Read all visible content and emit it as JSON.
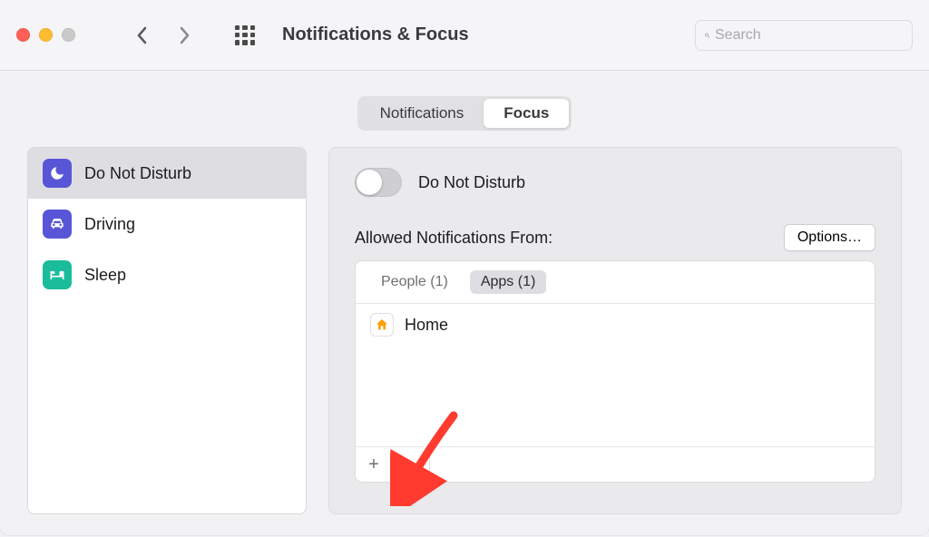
{
  "header": {
    "title": "Notifications & Focus",
    "search_placeholder": "Search"
  },
  "tabs": {
    "items": [
      "Notifications",
      "Focus"
    ],
    "active": 1
  },
  "sidebar": {
    "items": [
      {
        "label": "Do Not Disturb",
        "icon": "moon-icon",
        "color": "purple",
        "selected": true
      },
      {
        "label": "Driving",
        "icon": "car-icon",
        "color": "purple",
        "selected": false
      },
      {
        "label": "Sleep",
        "icon": "bed-icon",
        "color": "teal",
        "selected": false
      }
    ]
  },
  "main": {
    "toggle_label": "Do Not Disturb",
    "toggle_on": false,
    "allowed_heading": "Allowed Notifications From:",
    "options_label": "Options…",
    "filters": {
      "people_label": "People (1)",
      "apps_label": "Apps (1)",
      "active": "apps"
    },
    "apps": [
      {
        "name": "Home",
        "icon": "home-app-icon"
      }
    ],
    "footer": {
      "add": "+",
      "remove": "−"
    }
  }
}
